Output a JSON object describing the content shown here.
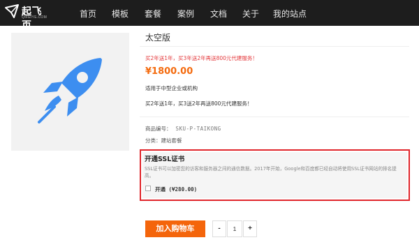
{
  "brand": {
    "name": "起飞页",
    "sub": "QIFEIYE.COM"
  },
  "nav": {
    "items": [
      "首页",
      "模板",
      "套餐",
      "案例",
      "文档",
      "关于",
      "我的站点"
    ]
  },
  "product": {
    "title": "太空版",
    "promo": "买2年送1年，买3年送2年再送800元代建服务！",
    "price": "¥1800.00",
    "desc1": "适用于中型企业或机构",
    "desc2": "买2年送1年，买3送2年再送800元代建服务！",
    "sku_label": "商品编号：",
    "sku_value": "SKU-P-TAIKONG",
    "category": "分类：建站套餐"
  },
  "ssl": {
    "title": "开通SSL证书",
    "desc": "SSL证书可以加密您的访客和服务器之间的通信数据。2017年开始，Google和百度都已经自动将使用SSL证书网站的排名提高。",
    "option": "开通 (¥280.00)"
  },
  "cart": {
    "add_label": "加入购物车",
    "minus": "-",
    "qty": "1",
    "plus": "+"
  },
  "colors": {
    "nav_bg": "#1d1d1d",
    "accent": "#f4650b",
    "promo": "#e4393c",
    "price": "#f46b0f",
    "icon_blue": "#3d8ef0",
    "highlight_border": "#e0252b"
  },
  "icons": {
    "logo": "paper-plane-logo-icon",
    "product": "rocket-icon",
    "checkbox": "checkbox-unchecked"
  }
}
